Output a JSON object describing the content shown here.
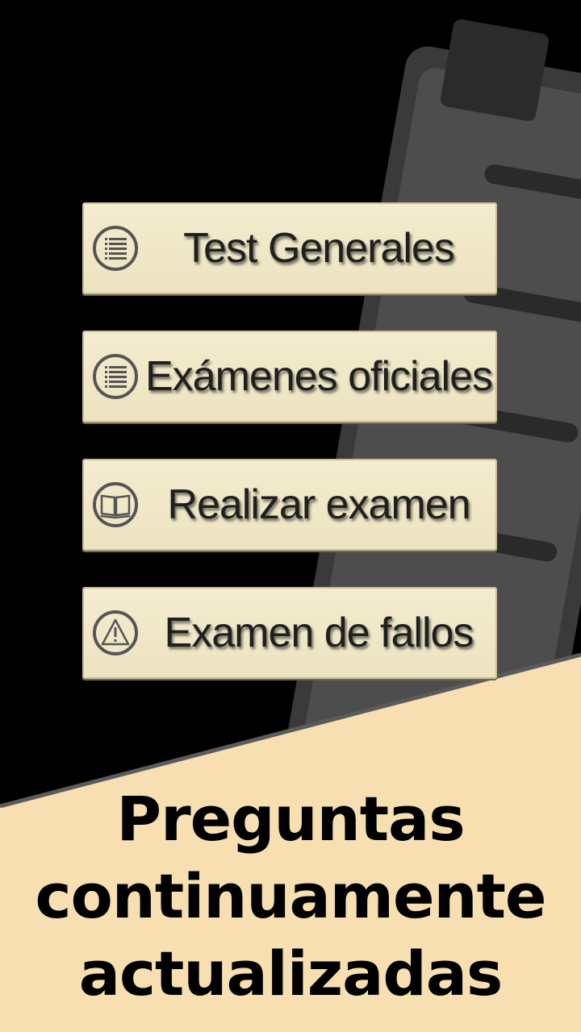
{
  "menu": {
    "items": [
      {
        "label": "Test Generales",
        "icon": "list-icon"
      },
      {
        "label": "Exámenes oficiales",
        "icon": "list-icon"
      },
      {
        "label": "Realizar examen",
        "icon": "open-book-icon"
      },
      {
        "label": "Examen de fallos",
        "icon": "warning-triangle-icon"
      }
    ]
  },
  "promo": {
    "lines": [
      "Preguntas",
      "continuamente",
      "actualizadas"
    ]
  },
  "colors": {
    "background": "#000000",
    "button_fill": "#f1e9c9",
    "promo_fill": "#f7dfb1",
    "checkmark_blue": "#2f5f86"
  }
}
